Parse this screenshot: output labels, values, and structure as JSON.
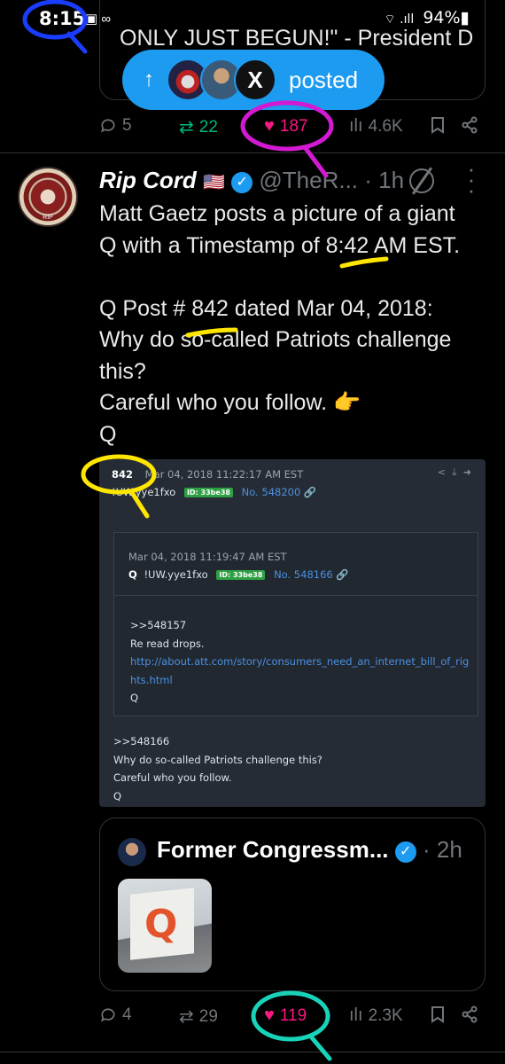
{
  "status_bar": {
    "time": "8:15",
    "notification_icons": "▣ ∞",
    "signal": "⌔ .ıll",
    "battery": "94%▮"
  },
  "top_quote": {
    "text": "ONLY JUST BEGUN!\" - President D"
  },
  "posted_pill": {
    "arrow": "↑",
    "label": "posted",
    "avatar_x_text": "X"
  },
  "top_actions": {
    "replies": "5",
    "reposts": "22",
    "likes": "187",
    "views": "4.6K"
  },
  "tweet": {
    "avatar_text": "RIP",
    "name": "Rip Cord",
    "flag": "🇺🇸",
    "verified_glyph": "✓",
    "handle": "@TheR...",
    "time": "· 1h",
    "lines": [
      "Matt Gaetz posts a picture of a giant",
      "Q with a Timestamp of 8:42 AM EST.",
      "",
      "Q Post # 842 dated Mar 04, 2018:",
      "Why do so-called Patriots challenge",
      "this?",
      "Careful who you follow. 👉",
      "Q"
    ]
  },
  "qpost": {
    "number": "842",
    "timestamp": "Mar 04, 2018 11:22:17 AM EST",
    "tripcode": "!UW.yye1fxo",
    "id_badge": "ID: 33be38",
    "post_no": "No. 548200 🔗",
    "tools": "< ⤓ ➜",
    "inner": {
      "timestamp": "Mar 04, 2018 11:19:47 AM EST",
      "author": "Q",
      "tripcode": "!UW.yye1fxo",
      "id_badge": "ID: 33be38",
      "post_no": "No. 548166 🔗",
      "ref": ">>548157",
      "line1": "Re read drops.",
      "link1": "http://about.att.com/story/consumers_need_an_internet_bill_of_rig",
      "link2": "hts.html",
      "sign": "Q"
    },
    "outer": {
      "ref": ">>548166",
      "line1": "Why do so-called Patriots challenge this?",
      "line2": "Careful who you follow.",
      "sign": "Q"
    }
  },
  "quoted_tweet": {
    "name": "Former Congressm...",
    "verified_glyph": "✓",
    "time": "· 2h",
    "photo_glyph": "Q"
  },
  "bottom_actions": {
    "replies": "4",
    "reposts": "29",
    "likes": "119",
    "views": "2.3K"
  },
  "icons": {
    "reply": "reply-icon",
    "repost": "repost-icon",
    "like": "heart-icon",
    "views": "views-icon",
    "bookmark": "bookmark-icon",
    "share": "share-icon"
  },
  "colors": {
    "background": "#000000",
    "accent": "#1d9bf0",
    "like": "#f91880",
    "repost": "#00ba7c",
    "muted": "#71767b",
    "annotation_blue": "#1a3cff",
    "annotation_magenta": "#d21ad2",
    "annotation_yellow": "#ffe600",
    "annotation_teal": "#19d3b9"
  }
}
